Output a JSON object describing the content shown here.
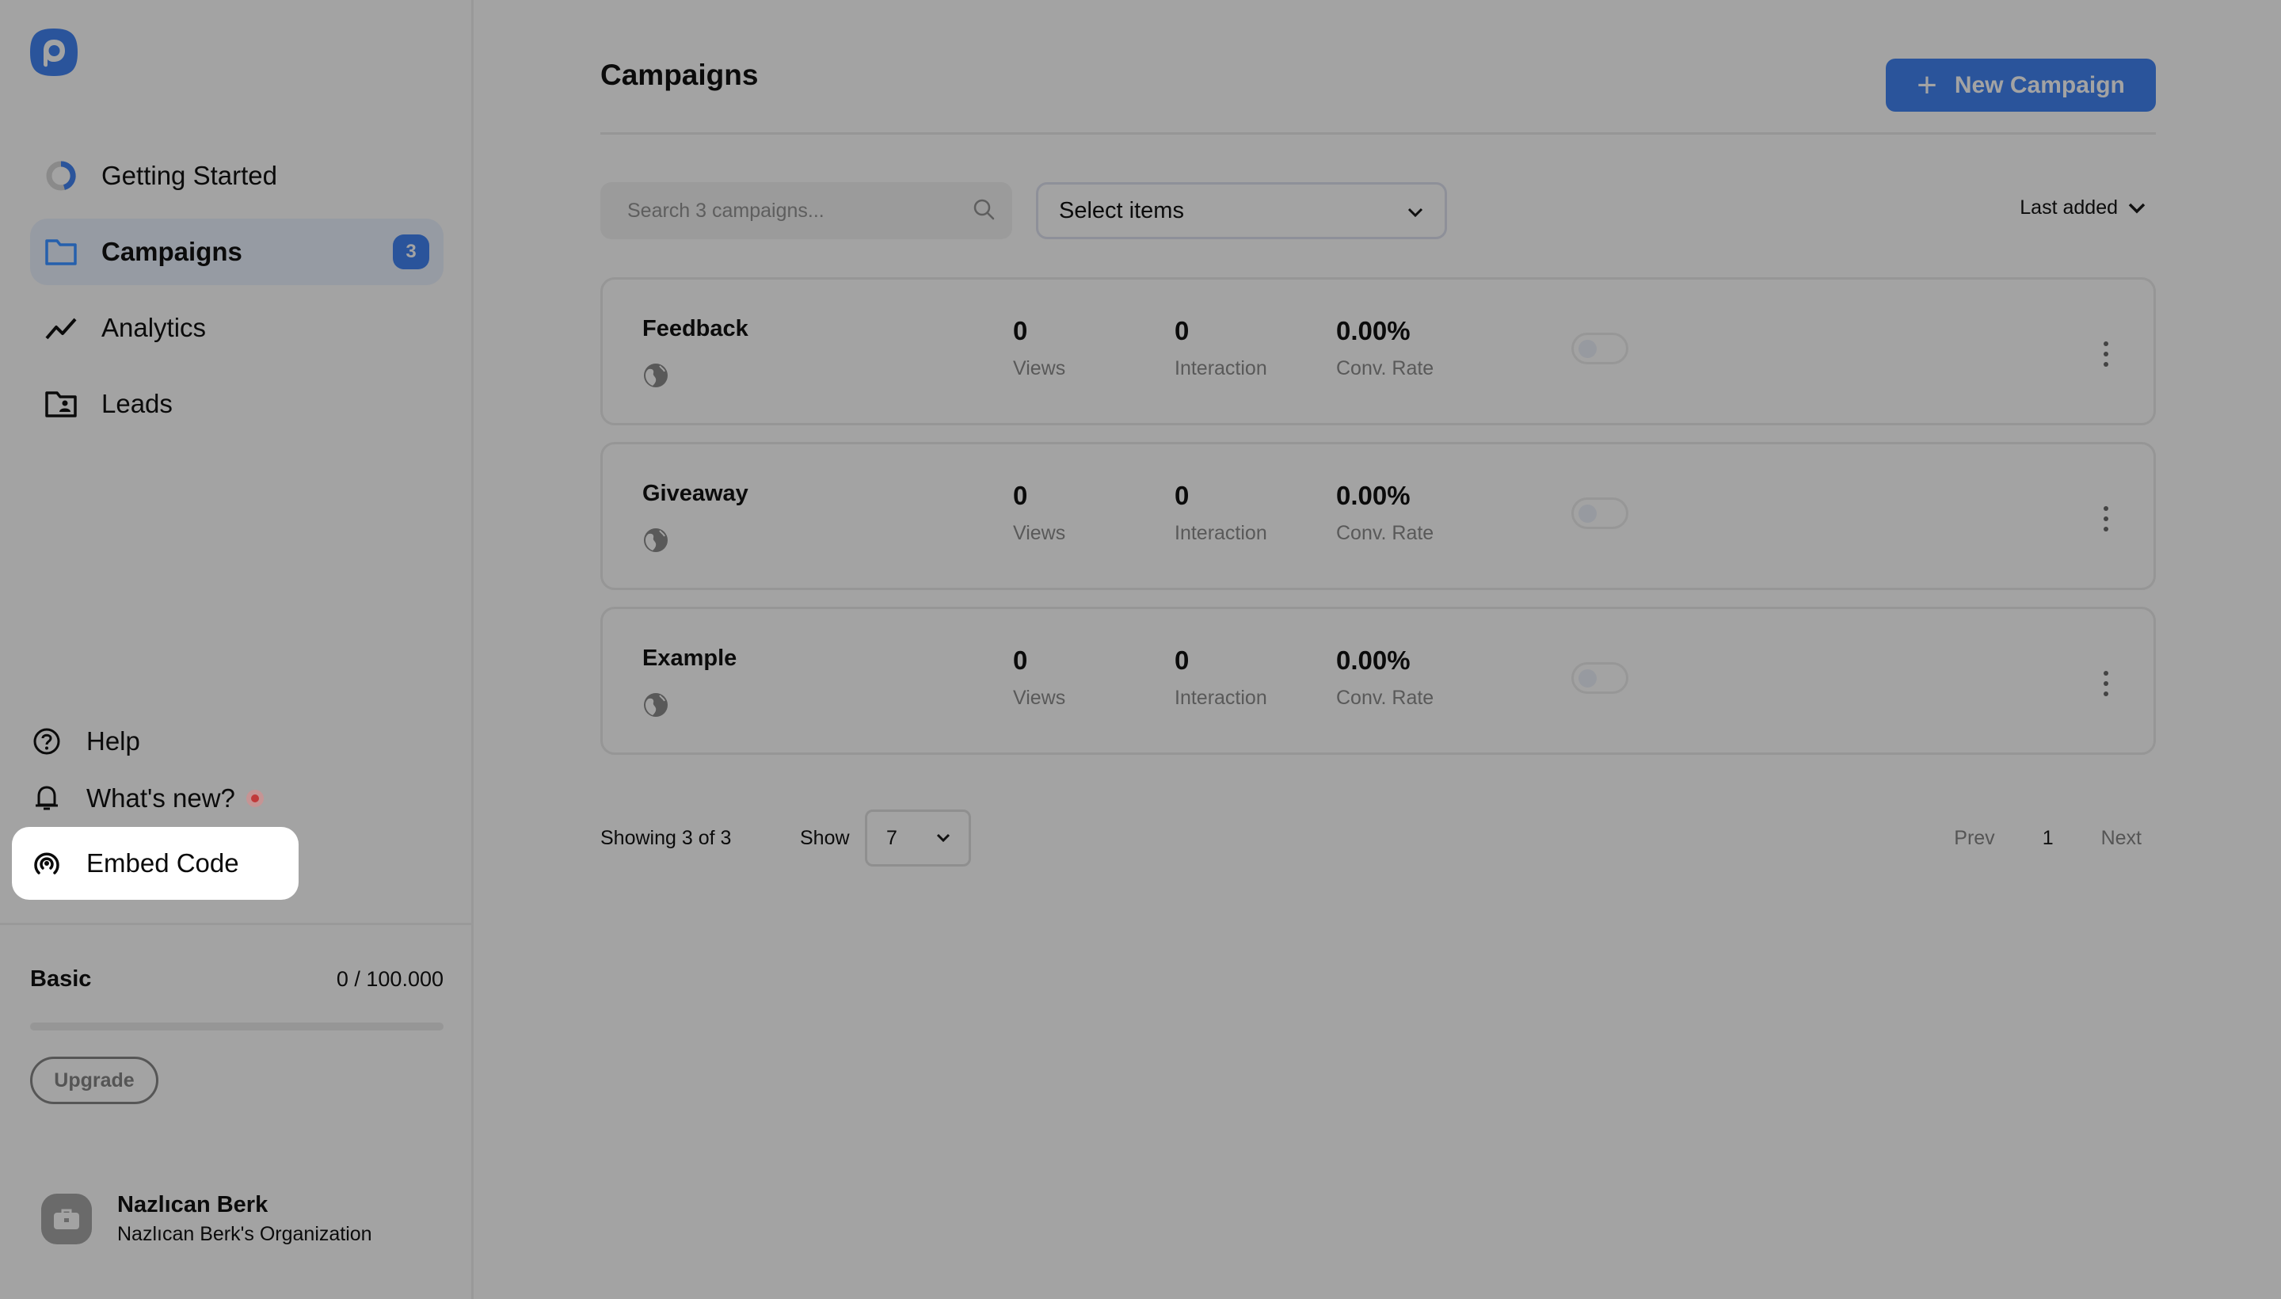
{
  "brand": {
    "logo": "app-logo",
    "color": "#2a549b"
  },
  "sidebar": {
    "items": [
      {
        "label": "Getting Started",
        "icon": "progress-ring-icon",
        "progress": 0.3
      },
      {
        "label": "Campaigns",
        "icon": "folder-icon",
        "badge": "3",
        "active": true
      },
      {
        "label": "Analytics",
        "icon": "trend-line-icon"
      },
      {
        "label": "Leads",
        "icon": "contact-folder-icon"
      }
    ],
    "bottom_items": [
      {
        "label": "Help",
        "icon": "help-circle-icon"
      },
      {
        "label": "What's new?",
        "icon": "bell-icon",
        "notification": true
      },
      {
        "label": "Embed Code",
        "icon": "broadcast-icon",
        "highlighted": true
      }
    ],
    "plan": {
      "name": "Basic",
      "usage": "0 / 100.000",
      "progress": 0,
      "upgrade_label": "Upgrade"
    },
    "user": {
      "name": "Nazlıcan Berk",
      "organization": "Nazlıcan Berk's Organization",
      "avatar_icon": "briefcase-icon"
    }
  },
  "main": {
    "title": "Campaigns",
    "new_button": "New Campaign",
    "search": {
      "placeholder": "Search 3 campaigns...",
      "value": ""
    },
    "filter": {
      "label": "Select items"
    },
    "sort": {
      "label": "Last added"
    },
    "stat_labels": {
      "views": "Views",
      "interaction": "Interaction",
      "conv_rate": "Conv. Rate"
    },
    "campaigns": [
      {
        "name": "Feedback",
        "views": "0",
        "interaction": "0",
        "conv_rate": "0.00%",
        "enabled": false
      },
      {
        "name": "Giveaway",
        "views": "0",
        "interaction": "0",
        "conv_rate": "0.00%",
        "enabled": false
      },
      {
        "name": "Example",
        "views": "0",
        "interaction": "0",
        "conv_rate": "0.00%",
        "enabled": false
      }
    ],
    "footer": {
      "showing": "Showing 3 of 3",
      "show_label": "Show",
      "page_size": "7",
      "prev": "Prev",
      "page": "1",
      "next": "Next"
    }
  }
}
